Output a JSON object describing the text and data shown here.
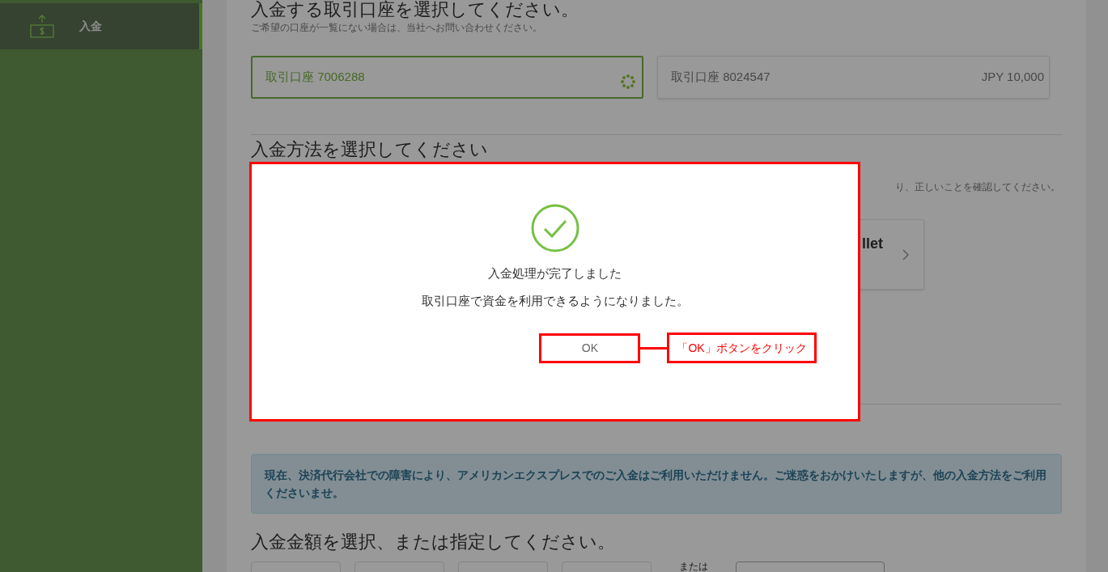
{
  "sidebar": {
    "items": [
      {
        "label": "入金",
        "selected": true
      }
    ]
  },
  "account_section": {
    "heading": "入金する取引口座を選択してください。",
    "note": "ご希望の口座が一覧にない場合は、当社へお問い合わせください。",
    "accounts": [
      {
        "name": "取引口座 7006288",
        "selected": true,
        "loading": true
      },
      {
        "name": "取引口座 8024547",
        "balance": "JPY 10,000",
        "selected": false,
        "loading": false
      }
    ]
  },
  "method_section": {
    "heading": "入金方法を選択してください",
    "note_fragment": "り、正しいことを確認してください。",
    "methods": [
      {
        "label_fragment": "llet"
      }
    ]
  },
  "alert": "現在、決済代行会社での障害により、アメリカンエクスプレスでのご入金はご利用いただけません。ご迷惑をおかけいたしますが、他の入金方法をご利用くださいませ。",
  "amount_section": {
    "heading": "入金金額を選択、または指定してください。",
    "or_label": "または"
  },
  "dialog": {
    "title": "入金処理が完了しました",
    "message": "取引口座で資金を利用できるようになりました。",
    "button": "OK"
  },
  "annotation": {
    "callout": "「OK」ボタンをクリック"
  }
}
